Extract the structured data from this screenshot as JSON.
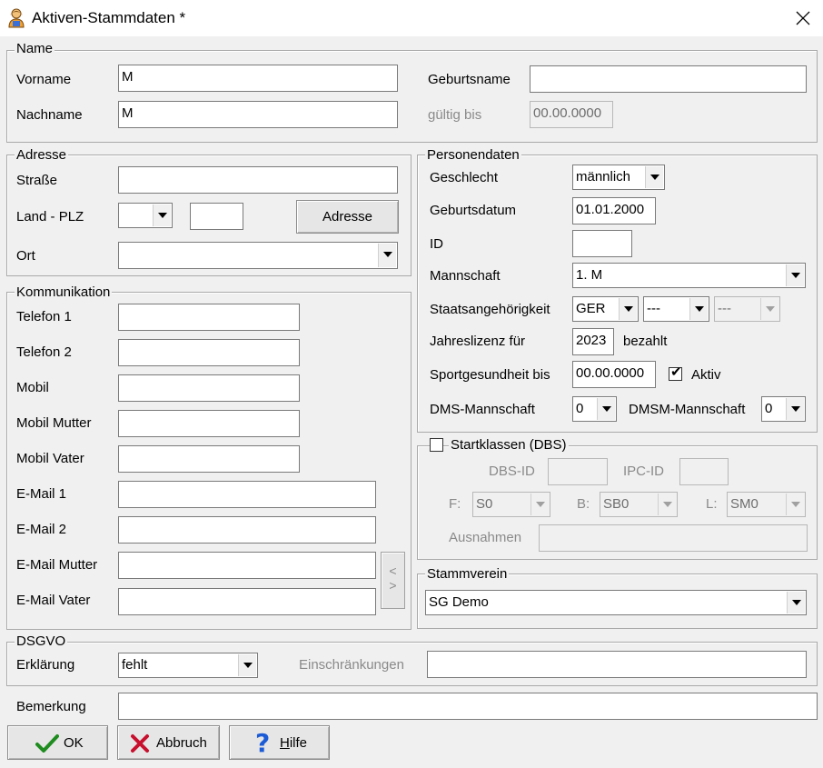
{
  "window": {
    "title": "Aktiven-Stammdaten *",
    "close_label": "✕"
  },
  "name_group": {
    "legend": "Name",
    "vorname_label": "Vorname",
    "vorname_value": "M",
    "nachname_label": "Nachname",
    "nachname_value": "M",
    "geburtsname_label": "Geburtsname",
    "geburtsname_value": "",
    "gueltig_bis_label": "gültig bis",
    "gueltig_bis_value": "00.00.0000"
  },
  "adresse": {
    "legend": "Adresse",
    "strasse_label": "Straße",
    "strasse_value": "",
    "land_plz_label": "Land - PLZ",
    "land_value": "",
    "plz_value": "",
    "adresse_button": "Adresse",
    "ort_label": "Ort",
    "ort_value": ""
  },
  "kommunikation": {
    "legend": "Kommunikation",
    "fields": [
      {
        "label": "Telefon 1",
        "value": ""
      },
      {
        "label": "Telefon 2",
        "value": ""
      },
      {
        "label": "Mobil",
        "value": ""
      },
      {
        "label": "Mobil Mutter",
        "value": ""
      },
      {
        "label": "Mobil Vater",
        "value": ""
      },
      {
        "label": "E-Mail 1",
        "value": ""
      },
      {
        "label": "E-Mail 2",
        "value": ""
      },
      {
        "label": "E-Mail Mutter",
        "value": ""
      },
      {
        "label": "E-Mail Vater",
        "value": ""
      }
    ],
    "nav_prev": "<",
    "nav_next": ">"
  },
  "personendaten": {
    "legend": "Personendaten",
    "geschlecht_label": "Geschlecht",
    "geschlecht_value": "männlich",
    "geburtsdatum_label": "Geburtsdatum",
    "geburtsdatum_value": "01.01.2000",
    "id_label": "ID",
    "id_value": "",
    "mannschaft_label": "Mannschaft",
    "mannschaft_value": "1. M",
    "staat_label": "Staatsangehörigkeit",
    "staat_value_1": "GER",
    "staat_value_2": "---",
    "staat_value_3": "---",
    "jahreslizenz_label": "Jahreslizenz für",
    "jahreslizenz_value": "2023",
    "bezahlt_label": "bezahlt",
    "sport_label": "Sportgesundheit bis",
    "sport_value": "00.00.0000",
    "aktiv_label": "Aktiv",
    "aktiv_checked": true,
    "dms_label": "DMS-Mannschaft",
    "dms_value": "0",
    "dmsm_label": "DMSM-Mannschaft",
    "dmsm_value": "0"
  },
  "startklassen": {
    "legend": "Startklassen (DBS)",
    "checked": false,
    "dbs_id_label": "DBS-ID",
    "dbs_id_value": "",
    "ipc_id_label": "IPC-ID",
    "ipc_id_value": "",
    "f_label": "F:",
    "f_value": "S0",
    "b_label": "B:",
    "b_value": "SB0",
    "l_label": "L:",
    "l_value": "SM0",
    "ausnahmen_label": "Ausnahmen",
    "ausnahmen_value": ""
  },
  "stammverein": {
    "legend": "Stammverein",
    "value": "SG Demo"
  },
  "dsgvo": {
    "legend": "DSGVO",
    "erklaerung_label": "Erklärung",
    "erklaerung_value": "fehlt",
    "einschraenkungen_label": "Einschränkungen",
    "einschraenkungen_value": ""
  },
  "bemerkung": {
    "label": "Bemerkung",
    "value": ""
  },
  "buttons": {
    "ok": "OK",
    "abbruch": "Abbruch",
    "hilfe_h": "H",
    "hilfe_rest": "ilfe"
  },
  "colors": {
    "ok_check": "#1e8c1e",
    "cancel_x": "#c8102e",
    "help_q": "#1c5bd6"
  }
}
